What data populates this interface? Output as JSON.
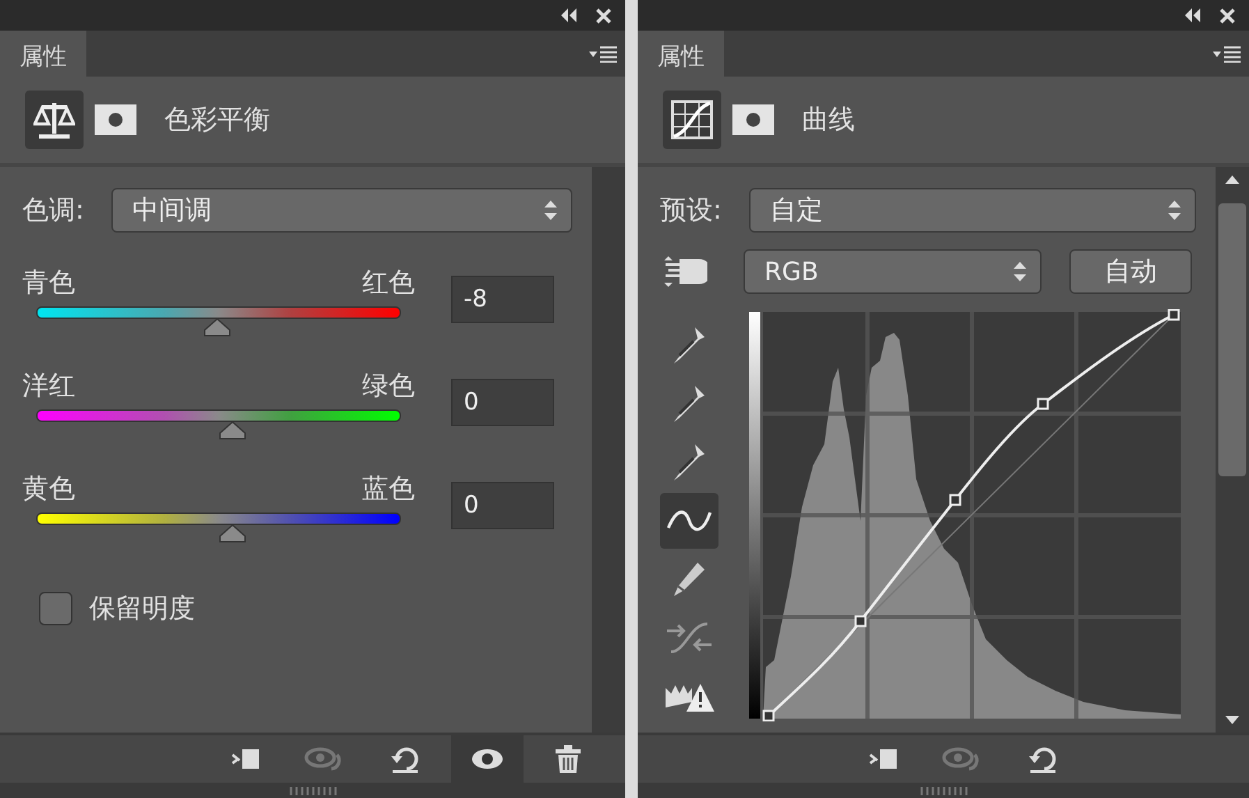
{
  "panels": [
    {
      "kind": "color-balance",
      "tabs": [
        {
          "label": "属性",
          "selected": true
        }
      ],
      "header_icons": [
        {
          "kind": "adjustment",
          "selected": true
        },
        {
          "kind": "mask",
          "selected": false
        }
      ],
      "title": "色彩平衡",
      "tone": {
        "label": "色调:",
        "value": "中间调"
      },
      "sliders": [
        {
          "kind": "cyan-red",
          "left": "青色",
          "right": "红色",
          "level": 0.46,
          "value": "-8"
        },
        {
          "kind": "magenta-green",
          "left": "洋红",
          "right": "绿色",
          "level": 0.5,
          "value": "0"
        },
        {
          "kind": "yellow-blue",
          "left": "黄色",
          "right": "蓝色",
          "level": 0.5,
          "value": "0"
        }
      ],
      "preserve": {
        "label": "保留明度",
        "checked": false
      },
      "toolbar": [
        {
          "kind": "clip",
          "selected": false
        },
        {
          "kind": "previous",
          "selected": false
        },
        {
          "kind": "reset",
          "selected": false
        },
        {
          "kind": "visibility",
          "selected": true
        },
        {
          "kind": "delete",
          "selected": false
        }
      ]
    },
    {
      "kind": "curves",
      "tabs": [
        {
          "label": "属性",
          "selected": true
        }
      ],
      "header_icons": [
        {
          "kind": "adjustment",
          "selected": true
        },
        {
          "kind": "mask",
          "selected": false
        }
      ],
      "title": "曲线",
      "preset": {
        "label": "预设:",
        "value": "自定"
      },
      "channel": {
        "value": "RGB",
        "button": "自动"
      },
      "tools": [
        {
          "kind": "eyedropper",
          "selected": false
        },
        {
          "kind": "eyedropper",
          "selected": false
        },
        {
          "kind": "eyedropper",
          "selected": false
        },
        {
          "kind": "curve",
          "selected": true
        },
        {
          "kind": "pencil",
          "selected": false
        },
        {
          "kind": "smooth",
          "selected": false
        },
        {
          "kind": "clipping",
          "selected": false
        }
      ],
      "toolbar": [
        {
          "kind": "clip",
          "selected": false
        },
        {
          "kind": "previous",
          "selected": false
        },
        {
          "kind": "reset",
          "selected": false
        }
      ]
    }
  ]
}
